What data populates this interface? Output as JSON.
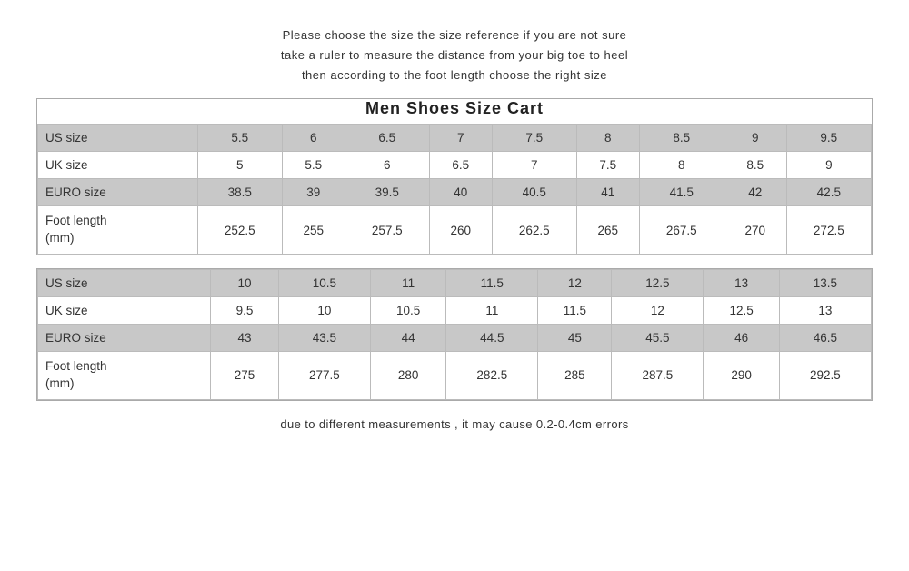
{
  "instructions": {
    "line1": "Please choose the size the size reference if you are not sure",
    "line2": "take a ruler to measure the distance from your big toe to heel",
    "line3": "then  according  to  the foot length  choose  the right size"
  },
  "title": "Men   Shoes   Size   Cart",
  "table1": {
    "rows": [
      {
        "label": "US size",
        "values": [
          "5.5",
          "6",
          "6.5",
          "7",
          "7.5",
          "8",
          "8.5",
          "9",
          "9.5"
        ],
        "shaded": true
      },
      {
        "label": "UK size",
        "values": [
          "5",
          "5.5",
          "6",
          "6.5",
          "7",
          "7.5",
          "8",
          "8.5",
          "9"
        ],
        "shaded": false
      },
      {
        "label": "EURO size",
        "values": [
          "38.5",
          "39",
          "39.5",
          "40",
          "40.5",
          "41",
          "41.5",
          "42",
          "42.5"
        ],
        "shaded": true
      },
      {
        "label": "Foot length\n(mm)",
        "values": [
          "252.5",
          "255",
          "257.5",
          "260",
          "262.5",
          "265",
          "267.5",
          "270",
          "272.5"
        ],
        "shaded": false
      }
    ]
  },
  "table2": {
    "rows": [
      {
        "label": "US size",
        "values": [
          "10",
          "10.5",
          "11",
          "11.5",
          "12",
          "12.5",
          "13",
          "13.5"
        ],
        "shaded": true
      },
      {
        "label": "UK size",
        "values": [
          "9.5",
          "10",
          "10.5",
          "11",
          "11.5",
          "12",
          "12.5",
          "13"
        ],
        "shaded": false
      },
      {
        "label": "EURO size",
        "values": [
          "43",
          "43.5",
          "44",
          "44.5",
          "45",
          "45.5",
          "46",
          "46.5"
        ],
        "shaded": true
      },
      {
        "label": "Foot length\n(mm)",
        "values": [
          "275",
          "277.5",
          "280",
          "282.5",
          "285",
          "287.5",
          "290",
          "292.5"
        ],
        "shaded": false
      }
    ]
  },
  "footer": "due to different measurements , it may cause 0.2-0.4cm errors"
}
